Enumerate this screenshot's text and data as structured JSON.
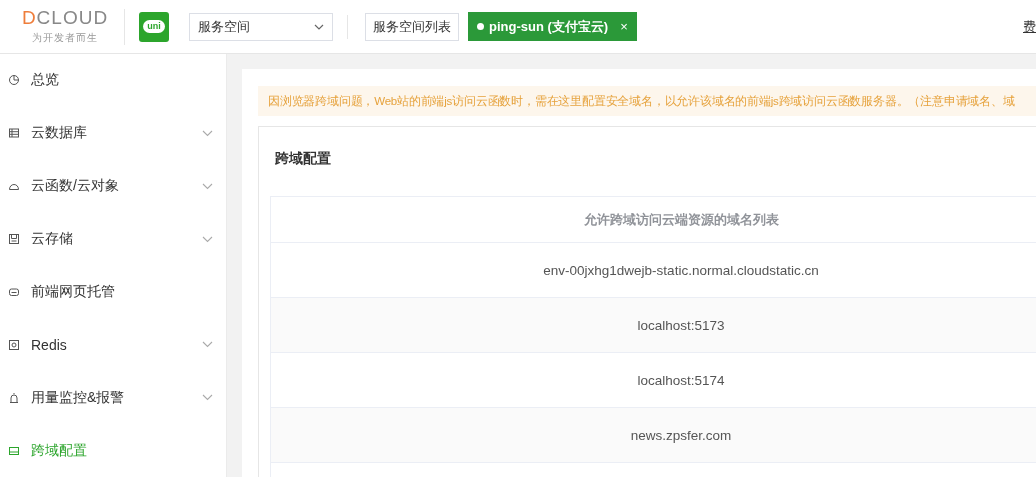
{
  "header": {
    "logo": {
      "name": "DCLOUD",
      "tagline": "为开发者而生"
    },
    "app_badge": "uni",
    "space_select": {
      "value": "服务空间"
    },
    "space_list_button": "服务空间列表",
    "space_tag": {
      "label": "ping-sun (支付宝云)",
      "close": "×"
    },
    "user_link": "费"
  },
  "sidebar": {
    "items": [
      {
        "label": "总览",
        "kind": "link",
        "selected": false
      },
      {
        "label": "云数据库",
        "kind": "group",
        "expanded": false,
        "selected": false
      },
      {
        "label": "云函数/云对象",
        "kind": "group",
        "expanded": false,
        "selected": false
      },
      {
        "label": "云存储",
        "kind": "group",
        "expanded": false,
        "selected": false
      },
      {
        "label": "前端网页托管",
        "kind": "link",
        "selected": false
      },
      {
        "label": "Redis",
        "kind": "group",
        "expanded": false,
        "selected": false
      },
      {
        "label": "用量监控&报警",
        "kind": "group",
        "expanded": false,
        "selected": false
      },
      {
        "label": "跨域配置",
        "kind": "link",
        "selected": true
      }
    ]
  },
  "notice": "因浏览器跨域问题，Web站的前端js访问云函数时，需在这里配置安全域名，以允许该域名的前端js跨域访问云函数服务器。（注意申请域名、域",
  "card": {
    "title": "跨域配置",
    "table": {
      "columns": [
        "允许跨域访问云端资源的域名列表"
      ],
      "rows": [
        [
          "env-00jxhg1dwejb-static.normal.cloudstatic.cn"
        ],
        [
          "localhost:5173"
        ],
        [
          "localhost:5174"
        ],
        [
          "news.zpsfer.com"
        ]
      ]
    }
  }
}
